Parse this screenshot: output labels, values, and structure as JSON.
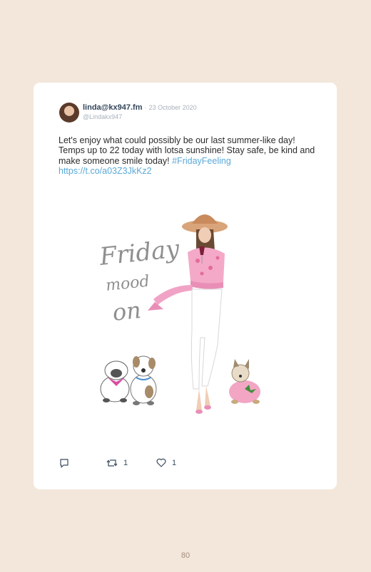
{
  "tweet": {
    "display_name": "linda@kx947.fm",
    "date_separator": "·",
    "date": "23 October 2020",
    "handle": "@Lindakx947",
    "text": "Let's enjoy what could possibly be our last summer-like day! Temps up to 22 today with lotsa sunshine! Stay safe, be kind and make someone smile today! ",
    "hashtag": "#FridayFeeling",
    "link": "https://t.co/a03Z3JkKz2"
  },
  "illustration": {
    "script_lines": [
      "Friday",
      "mood",
      "on"
    ]
  },
  "actions": {
    "reply_icon": "reply-icon",
    "retweet_icon": "retweet-icon",
    "retweet_count": "1",
    "like_icon": "heart-icon",
    "like_count": "1"
  },
  "footer": {
    "page_number": "80"
  },
  "colors": {
    "background": "#f3e7dc",
    "card": "#ffffff",
    "link": "#5aa9d8",
    "accent_pink": "#e98fb7"
  }
}
